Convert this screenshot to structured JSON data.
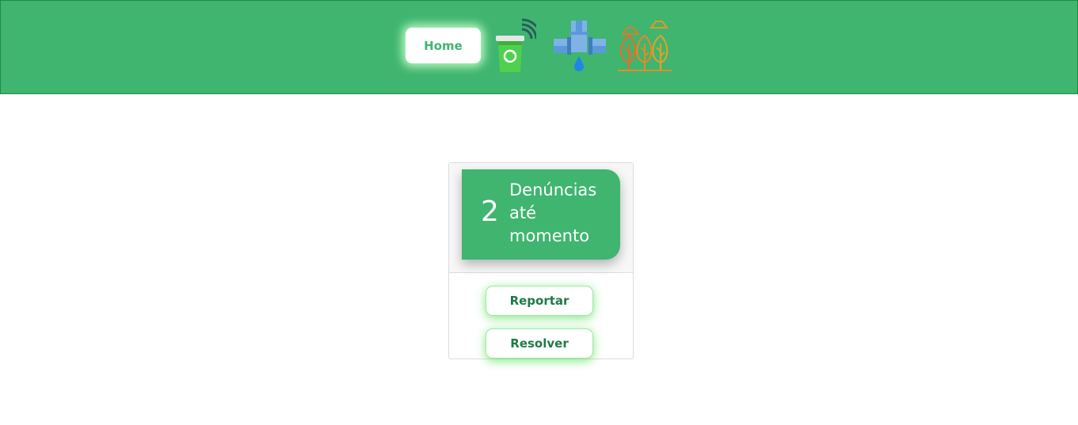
{
  "header": {
    "home_label": "Home",
    "nav_icons": [
      "smart-recycle-bin-icon",
      "water-pipe-leak-icon",
      "trees-icon"
    ],
    "background_color": "#3fb56f"
  },
  "card": {
    "count": "2",
    "count_label": "Denúncias até momento",
    "report_label": "Reportar",
    "resolve_label": "Resolver",
    "accent_color": "#3fb56f",
    "button_text_color": "#1e7a45"
  }
}
